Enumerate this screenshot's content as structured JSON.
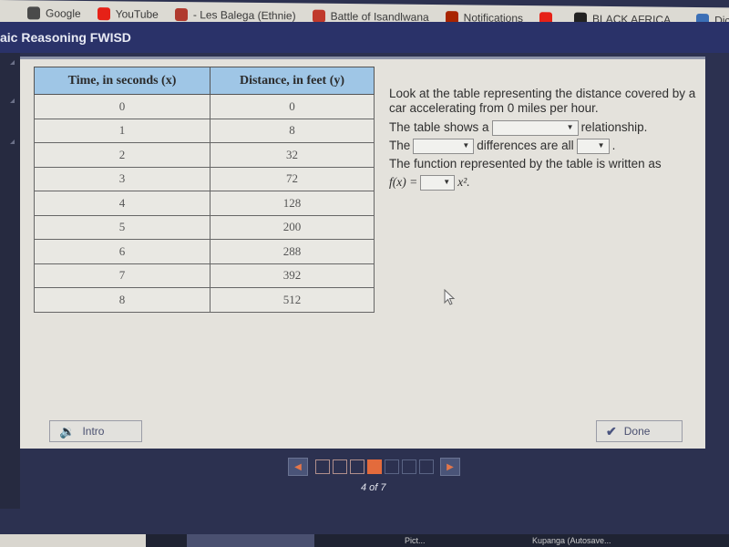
{
  "browser": {
    "bookmarks": [
      {
        "label": "Google",
        "icon": "google-icon",
        "color": "#4a4a4a"
      },
      {
        "label": "YouTube",
        "icon": "youtube-icon",
        "color": "#e62117"
      },
      {
        "label": "- Les Balega (Ethnie)",
        "icon": "globe-icon",
        "color": "#b03a2e"
      },
      {
        "label": "Battle of Isandlwana",
        "icon": "bb-icon",
        "color": "#c0392b"
      },
      {
        "label": "Notifications",
        "icon": "quora-icon",
        "color": "#a82400"
      },
      {
        "label": "",
        "icon": "youtube-icon",
        "color": "#e62117"
      },
      {
        "label": "BLACK AFRICA...",
        "icon": "cap-icon",
        "color": "#222222"
      },
      {
        "label": "Dictionary definitio...",
        "icon": "dictionary-icon",
        "color": "#3b6fb6"
      }
    ]
  },
  "header": {
    "title": "aic Reasoning FWISD"
  },
  "table": {
    "columns": [
      "Time, in seconds (x)",
      "Distance, in feet (y)"
    ],
    "rows": [
      [
        "0",
        "0"
      ],
      [
        "1",
        "8"
      ],
      [
        "2",
        "32"
      ],
      [
        "3",
        "72"
      ],
      [
        "4",
        "128"
      ],
      [
        "5",
        "200"
      ],
      [
        "6",
        "288"
      ],
      [
        "7",
        "392"
      ],
      [
        "8",
        "512"
      ]
    ]
  },
  "question": {
    "prompt": "Look at the table representing the distance covered by a car accelerating from 0 miles per hour.",
    "line1_pre": "The table shows a",
    "line1_post": "relationship.",
    "line2_pre": "The",
    "line2_mid": "differences are all",
    "line2_post": ".",
    "line3": "The function represented by the table is written as",
    "fx_label": "f(x) =",
    "fx_post": "x².",
    "dropdowns": {
      "relationship": "",
      "differences_type": "",
      "differences_value": "",
      "coefficient": ""
    },
    "dropdown_arrow": "▼"
  },
  "buttons": {
    "intro_label": "Intro",
    "intro_icon": "🔉",
    "done_label": "Done",
    "done_icon": "✔"
  },
  "pager": {
    "current": 4,
    "total": 7,
    "label": "4 of 7",
    "prev_icon": "◀",
    "next_icon": "▶",
    "accent": "#e36b3c"
  },
  "taskbar": {
    "items": [
      "",
      "Pict...",
      "Kupanga (Autosave..."
    ]
  }
}
